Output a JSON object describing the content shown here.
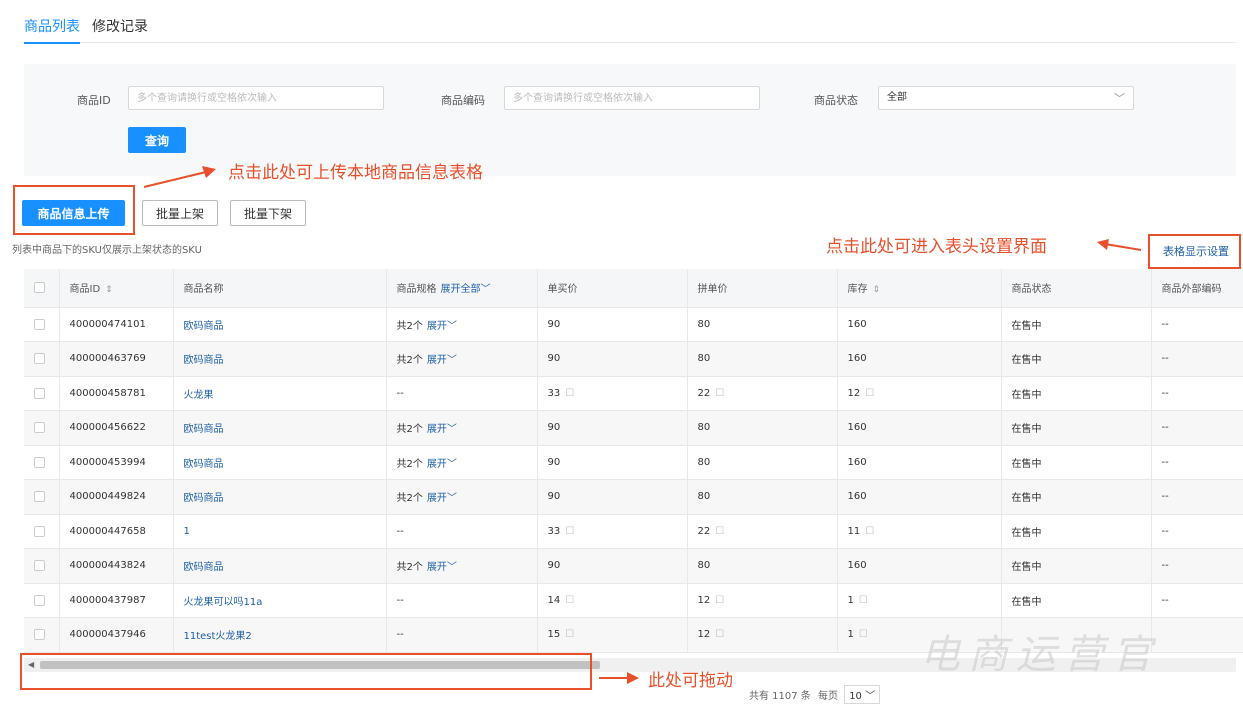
{
  "tabs": [
    {
      "label": "商品列表",
      "active": true
    },
    {
      "label": "修改记录",
      "active": false
    }
  ],
  "filters": {
    "id_label": "商品ID",
    "id_placeholder": "多个查询请换行或空格依次输入",
    "code_label": "商品编码",
    "code_placeholder": "多个查询请换行或空格依次输入",
    "status_label": "商品状态",
    "status_value": "全部",
    "search_button": "查询"
  },
  "toolbar": {
    "upload": "商品信息上传",
    "batch_on": "批量上架",
    "batch_off": "批量下架"
  },
  "annotations": {
    "upload": "点击此处可上传本地商品信息表格",
    "settings": "点击此处可进入表头设置界面",
    "scroll": "此处可拖动"
  },
  "note": "列表中商品下的SKU仅展示上架状态的SKU",
  "table_settings": "表格显示设置",
  "columns": {
    "id": "商品ID",
    "name": "商品名称",
    "spec": "商品规格",
    "spec_expand_all": "展开全部",
    "single_price": "单买价",
    "group_price": "拼单价",
    "stock": "库存",
    "status": "商品状态",
    "ext_code": "商品外部编码"
  },
  "rows": [
    {
      "id": "400000474101",
      "name": "欧码商品",
      "spec": "共2个",
      "expand": "展开",
      "single": "90",
      "group": "80",
      "stock": "160",
      "status": "在售中",
      "ext": "--",
      "editable": false
    },
    {
      "id": "400000463769",
      "name": "欧码商品",
      "spec": "共2个",
      "expand": "展开",
      "single": "90",
      "group": "80",
      "stock": "160",
      "status": "在售中",
      "ext": "--",
      "editable": false
    },
    {
      "id": "400000458781",
      "name": "火龙果",
      "spec": "--",
      "expand": "",
      "single": "33",
      "group": "22",
      "stock": "12",
      "status": "在售中",
      "ext": "--",
      "editable": true
    },
    {
      "id": "400000456622",
      "name": "欧码商品",
      "spec": "共2个",
      "expand": "展开",
      "single": "90",
      "group": "80",
      "stock": "160",
      "status": "在售中",
      "ext": "--",
      "editable": false
    },
    {
      "id": "400000453994",
      "name": "欧码商品",
      "spec": "共2个",
      "expand": "展开",
      "single": "90",
      "group": "80",
      "stock": "160",
      "status": "在售中",
      "ext": "--",
      "editable": false
    },
    {
      "id": "400000449824",
      "name": "欧码商品",
      "spec": "共2个",
      "expand": "展开",
      "single": "90",
      "group": "80",
      "stock": "160",
      "status": "在售中",
      "ext": "--",
      "editable": false
    },
    {
      "id": "400000447658",
      "name": "1",
      "spec": "--",
      "expand": "",
      "single": "33",
      "group": "22",
      "stock": "11",
      "status": "在售中",
      "ext": "--",
      "editable": true
    },
    {
      "id": "400000443824",
      "name": "欧码商品",
      "spec": "共2个",
      "expand": "展开",
      "single": "90",
      "group": "80",
      "stock": "160",
      "status": "在售中",
      "ext": "--",
      "editable": false
    },
    {
      "id": "400000437987",
      "name": "火龙果可以吗11a",
      "spec": "--",
      "expand": "",
      "single": "14",
      "group": "12",
      "stock": "1",
      "status": "在售中",
      "ext": "--",
      "editable": true
    },
    {
      "id": "400000437946",
      "name": "11test火龙果2",
      "spec": "--",
      "expand": "",
      "single": "15",
      "group": "12",
      "stock": "1",
      "status": "",
      "ext": "",
      "editable": true
    }
  ],
  "pagination": {
    "total": "共有 1107 条",
    "per_page_label": "每页",
    "per_page": "10"
  },
  "watermark": "电商运营官",
  "colors": {
    "primary": "#1890ff",
    "annotation": "#e8502c",
    "link": "#1f5fa8"
  }
}
